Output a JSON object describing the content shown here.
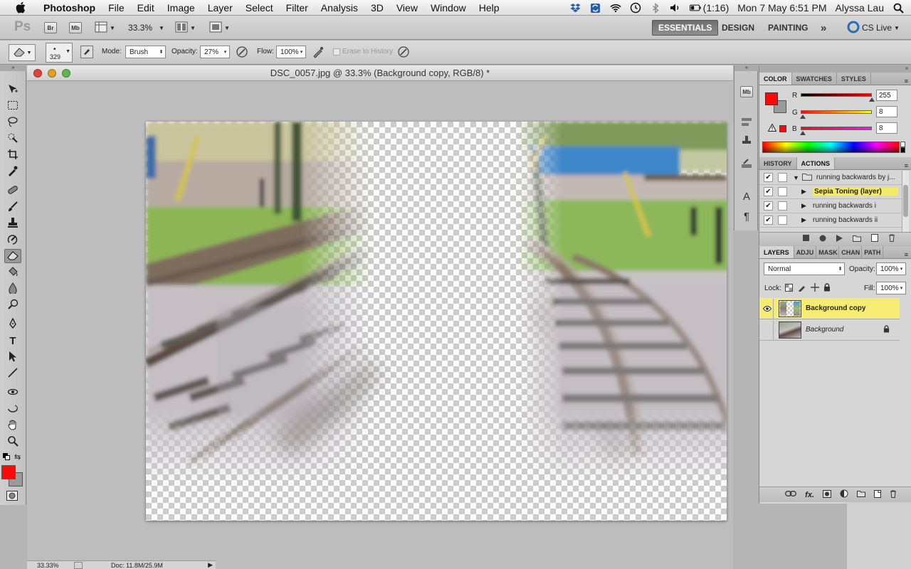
{
  "menubar": {
    "app_name": "Photoshop",
    "items": [
      "File",
      "Edit",
      "Image",
      "Layer",
      "Select",
      "Filter",
      "Analysis",
      "3D",
      "View",
      "Window",
      "Help"
    ],
    "battery": "(1:16)",
    "datetime": "Mon 7 May  6:51 PM",
    "user": "Alyssa Lau"
  },
  "appbar": {
    "ps_logo": "Ps",
    "bridge": "Br",
    "minibridge": "Mb",
    "zoom": "33.3%",
    "workspaces": [
      "ESSENTIALS",
      "DESIGN",
      "PAINTING"
    ],
    "active_workspace": "ESSENTIALS",
    "more": "»",
    "cs_live": "CS Live"
  },
  "options": {
    "brush_size": "329",
    "mode_label": "Mode:",
    "mode_value": "Brush",
    "opacity_label": "Opacity:",
    "opacity_value": "27%",
    "flow_label": "Flow:",
    "flow_value": "100%",
    "erase_history_label": "Erase to History"
  },
  "document": {
    "title": "DSC_0057.jpg @ 33.3% (Background copy, RGB/8) *"
  },
  "status": {
    "zoom": "33.33%",
    "doc": "Doc: 11.8M/25.9M"
  },
  "dock": {
    "mb": "Mb",
    "text_a": "A",
    "para": "¶"
  },
  "color_panel": {
    "tabs": [
      "COLOR",
      "SWATCHES",
      "STYLES"
    ],
    "r_label": "R",
    "g_label": "G",
    "b_label": "B",
    "r": "255",
    "g": "8",
    "b": "8",
    "r_level": 1.0,
    "g_level": 0.03,
    "b_level": 0.03,
    "foreground": "#ff0808",
    "background": "#9a9a9a"
  },
  "history_panel": {
    "tabs": [
      "HISTORY",
      "ACTIONS"
    ],
    "active_tab": "ACTIONS",
    "set_name": "running backwards by j...",
    "actions": [
      "Sepia Toning (layer)",
      "running backwards i",
      "running backwards ii"
    ]
  },
  "layers_panel": {
    "tabs": [
      "LAYERS",
      "ADJU",
      "MASK",
      "CHAN",
      "PATH"
    ],
    "blend_mode": "Normal",
    "opacity_label": "Opacity:",
    "opacity": "100%",
    "lock_label": "Lock:",
    "fill_label": "Fill:",
    "fill": "100%",
    "layers": [
      {
        "name": "Background copy",
        "visible": true,
        "selected": true
      },
      {
        "name": "Background",
        "visible": false,
        "selected": false,
        "locked": true
      }
    ]
  }
}
